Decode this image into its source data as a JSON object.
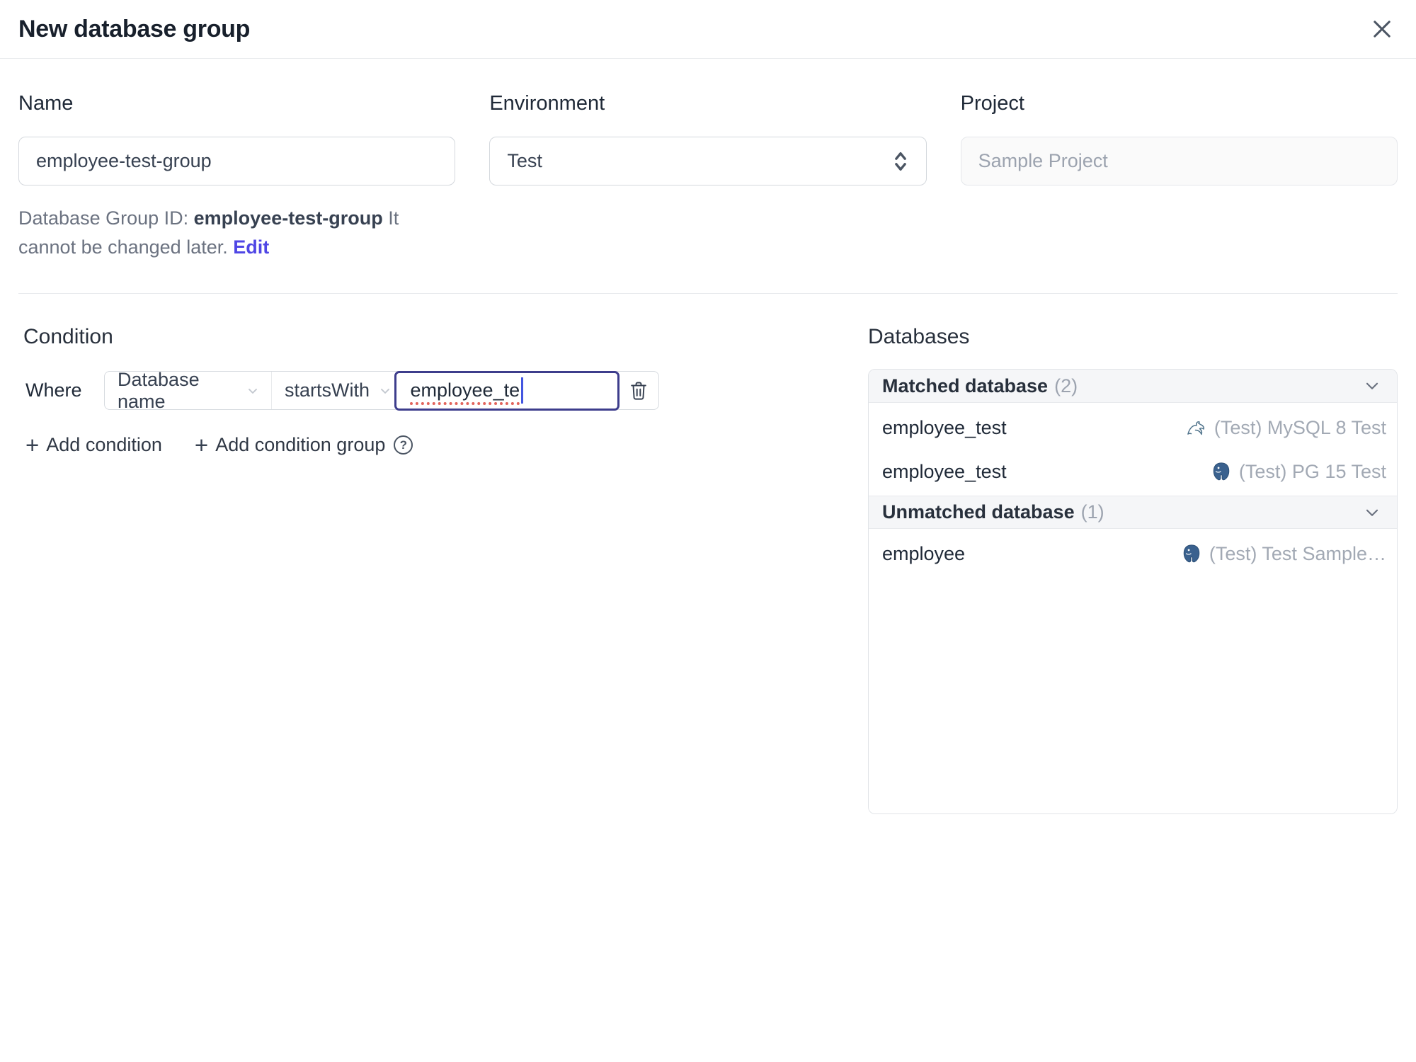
{
  "dialog": {
    "title": "New database group"
  },
  "form": {
    "name": {
      "label": "Name",
      "value": "employee-test-group"
    },
    "environment": {
      "label": "Environment",
      "value": "Test"
    },
    "project": {
      "label": "Project",
      "value": "Sample Project"
    },
    "group_id": {
      "prefix": "Database Group ID:",
      "value": "employee-test-group",
      "note": "It cannot be changed later.",
      "edit": "Edit"
    }
  },
  "condition": {
    "heading": "Condition",
    "where": "Where",
    "field": "Database name",
    "operator": "startsWith",
    "value": "employee_te",
    "plus": "+",
    "add_condition": "Add condition",
    "add_condition_group": "Add condition group",
    "help": "?"
  },
  "databases": {
    "heading": "Databases",
    "matched": {
      "title": "Matched database",
      "count": "(2)"
    },
    "unmatched": {
      "title": "Unmatched database",
      "count": "(1)"
    },
    "rows": [
      {
        "name": "employee_test",
        "engine": "mysql",
        "instance": "(Test) MySQL 8 Test"
      },
      {
        "name": "employee_test",
        "engine": "postgres",
        "instance": "(Test) PG 15 Test"
      },
      {
        "name": "employee",
        "engine": "postgres",
        "instance": "(Test) Test Sample…"
      }
    ]
  },
  "colors": {
    "accent_indigo": "#4f46e5",
    "focus_border": "#3d3d8c",
    "group_header_bg": "#f5f6f8",
    "border": "#e8eaed",
    "muted_text": "#9ca3af",
    "spellcheck_red": "#e2645c"
  }
}
